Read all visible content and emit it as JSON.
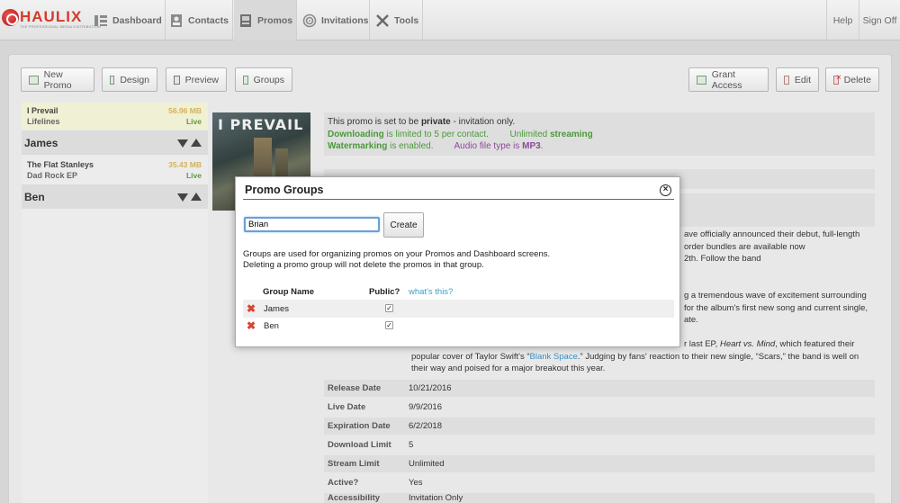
{
  "brand": {
    "name": "HAULIX",
    "tagline": "THE PROFESSIONAL MEDIA DISTRIBUTION"
  },
  "nav": {
    "items": [
      {
        "label": "Dashboard",
        "icon": "dashboard-icon"
      },
      {
        "label": "Contacts",
        "icon": "contacts-icon"
      },
      {
        "label": "Promos",
        "icon": "promos-icon"
      },
      {
        "label": "Invitations",
        "icon": "invitations-icon"
      },
      {
        "label": "Tools",
        "icon": "tools-icon"
      }
    ],
    "help": "Help",
    "sign_off": "Sign Off"
  },
  "toolbar": {
    "new_promo": "New Promo",
    "design": "Design",
    "preview": "Preview",
    "groups": "Groups",
    "grant_access": "Grant Access",
    "edit": "Edit",
    "delete": "Delete"
  },
  "promos": [
    {
      "name": "I Prevail",
      "subtitle": "Lifelines",
      "size": "56.96 MB",
      "status": "Live"
    }
  ],
  "groups": [
    {
      "name": "James",
      "promos": [
        {
          "name": "The Flat Stanleys",
          "subtitle": "Dad Rock EP",
          "size": "35.43 MB",
          "status": "Live"
        }
      ]
    },
    {
      "name": "Ben",
      "promos": []
    }
  ],
  "cover": {
    "title": "I PREVAIL"
  },
  "info": {
    "line1_pre": "This promo is set to be ",
    "line1_bold": "private",
    "line1_post": " - invitation only.",
    "downloading": "Downloading",
    "downloading_text": " is limited to 5 per contact.",
    "unlimited_pre": "Unlimited ",
    "streaming": "streaming",
    "watermarking": "Watermarking",
    "watermark_text": " is enabled.",
    "audio_pre": "Audio file type is ",
    "audio_type": "MP3",
    "audio_post": "."
  },
  "description": {
    "p1_line1": "ave officially announced their debut, full-length",
    "p1_line2": "order bundles are available now",
    "p1_line3": "2th. Follow the band",
    "p2_line1": "g a tremendous wave of excitement surrounding",
    "p2_line2": "for the album's first new song and current single,",
    "p2_line3": "ate.",
    "p3_line1_suffix_pre": "r last EP, ",
    "p3_line1_em": "Heart vs. Mind",
    "p3_line1_post": ", which featured their",
    "p3_line2_pre": "popular cover of Taylor Swift's “",
    "p3_line2_link": "Blank Space",
    "p3_line2_post": ".” Judging by fans' reaction to their new single, “Scars,” the band is well on",
    "p3_line3": "their way and poised for a major breakout this year."
  },
  "details": [
    {
      "key": "Release Date",
      "value": "10/21/2016"
    },
    {
      "key": "Live Date",
      "value": "9/9/2016"
    },
    {
      "key": "Expiration Date",
      "value": "6/2/2018"
    },
    {
      "key": "Download Limit",
      "value": "5"
    },
    {
      "key": "Stream Limit",
      "value": "Unlimited"
    },
    {
      "key": "Active?",
      "value": "Yes"
    },
    {
      "key": "Accessibility",
      "value": "Invitation Only"
    }
  ],
  "modal": {
    "title": "Promo Groups",
    "input_value": "Brian",
    "create": "Create",
    "help_line1": "Groups are used for organizing promos on your Promos and Dashboard screens.",
    "help_line2": "Deleting a promo group will not delete the promos in that group.",
    "col_group": "Group Name",
    "col_public": "Public?",
    "whats_this": "what's this?",
    "rows": [
      {
        "name": "James",
        "public": true
      },
      {
        "name": "Ben",
        "public": true
      }
    ]
  }
}
